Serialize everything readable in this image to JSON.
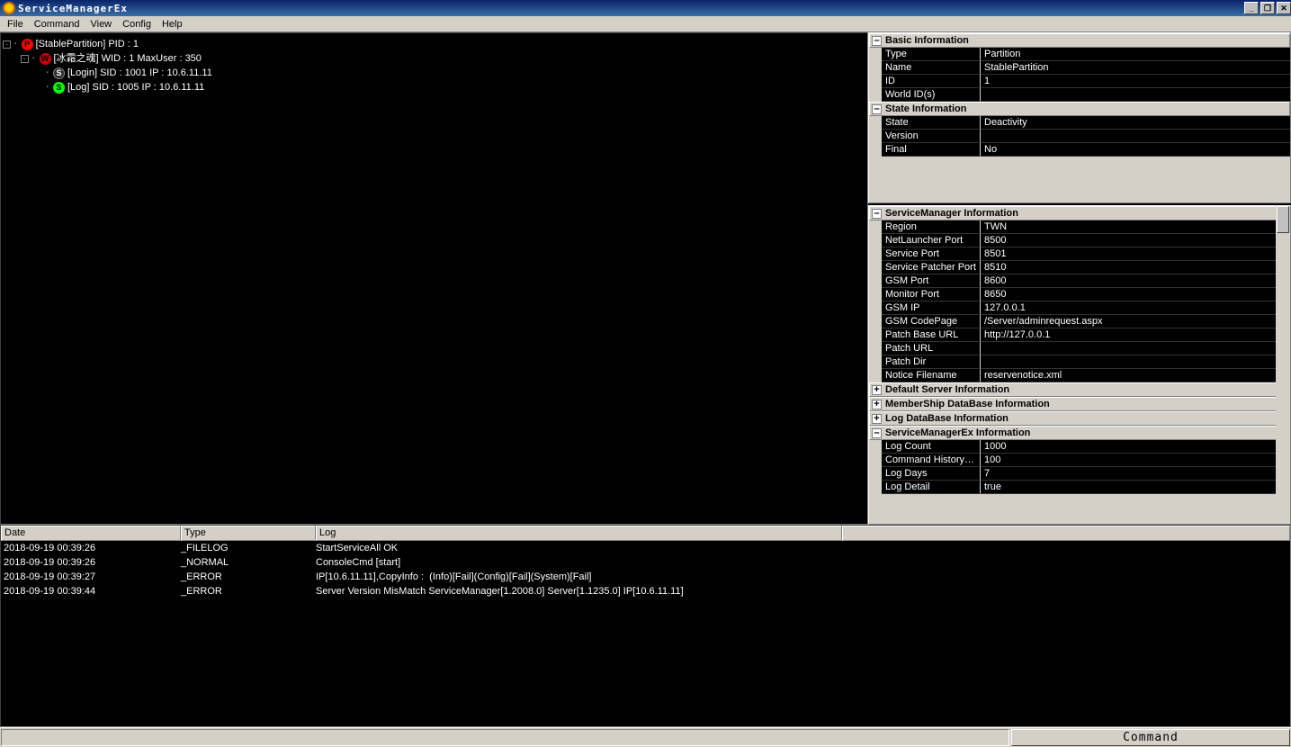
{
  "window": {
    "title": "ServiceManagerEx"
  },
  "menu": [
    "File",
    "Command",
    "View",
    "Config",
    "Help"
  ],
  "tree": {
    "n0": {
      "label": "[StablePartition] PID : 1",
      "icon": "P",
      "cls": "ico-red"
    },
    "n1": {
      "label": "[冰霜之魂] WID : 1 MaxUser : 350",
      "icon": "W",
      "cls": "ico-darkred"
    },
    "n2": {
      "label": "[Login] SID : 1001 IP : 10.6.11.11",
      "icon": "S",
      "cls": "ico-black"
    },
    "n3": {
      "label": "[Log] SID : 1005 IP : 10.6.11.11",
      "icon": "S",
      "cls": "ico-green"
    }
  },
  "basic_info_title": "Basic Information",
  "basic_info": [
    {
      "k": "Type",
      "v": "Partition"
    },
    {
      "k": "Name",
      "v": "StablePartition"
    },
    {
      "k": "ID",
      "v": "1"
    },
    {
      "k": "World ID(s)",
      "v": ""
    }
  ],
  "state_info_title": "State Information",
  "state_info": [
    {
      "k": "State",
      "v": "Deactivity"
    },
    {
      "k": "Version",
      "v": ""
    },
    {
      "k": "Final",
      "v": "No"
    }
  ],
  "sm_info_title": "ServiceManager Information",
  "sm_info": [
    {
      "k": "Region",
      "v": "TWN"
    },
    {
      "k": "NetLauncher Port",
      "v": "8500"
    },
    {
      "k": "Service Port",
      "v": "8501"
    },
    {
      "k": "Service Patcher Port",
      "v": "8510"
    },
    {
      "k": "GSM Port",
      "v": "8600"
    },
    {
      "k": "Monitor Port",
      "v": "8650"
    },
    {
      "k": "GSM IP",
      "v": "127.0.0.1"
    },
    {
      "k": "GSM CodePage",
      "v": "/Server/adminrequest.aspx"
    },
    {
      "k": "Patch Base URL",
      "v": "http://127.0.0.1"
    },
    {
      "k": "Patch URL",
      "v": ""
    },
    {
      "k": "Patch Dir",
      "v": ""
    },
    {
      "k": "Notice Filename",
      "v": "reservenotice.xml"
    }
  ],
  "collapsed_sections": [
    "Default Server Information",
    "MemberShip DataBase Information",
    "Log DataBase Information"
  ],
  "smex_info_title": "ServiceManagerEx Information",
  "smex_info": [
    {
      "k": "Log Count",
      "v": "1000"
    },
    {
      "k": "Command History C...",
      "v": "100"
    },
    {
      "k": "Log Days",
      "v": "7"
    },
    {
      "k": "Log Detail",
      "v": "true"
    }
  ],
  "log_headers": {
    "date": "Date",
    "type": "Type",
    "log": "Log"
  },
  "log_rows": [
    {
      "d": "2018-09-19 00:39:26",
      "t": "_FILELOG",
      "l": "StartServiceAll OK"
    },
    {
      "d": "2018-09-19 00:39:26",
      "t": "_NORMAL",
      "l": "ConsoleCmd [start]"
    },
    {
      "d": "2018-09-19 00:39:27",
      "t": "_ERROR",
      "l": "IP[10.6.11.11],CopyInfo :  (Info)[Fail](Config)[Fail](System)[Fail]"
    },
    {
      "d": "2018-09-19 00:39:44",
      "t": "_ERROR",
      "l": "Server Version MisMatch ServiceManager[1.2008.0] Server[1.1235.0] IP[10.6.11.11]"
    }
  ],
  "command_button": "Command"
}
